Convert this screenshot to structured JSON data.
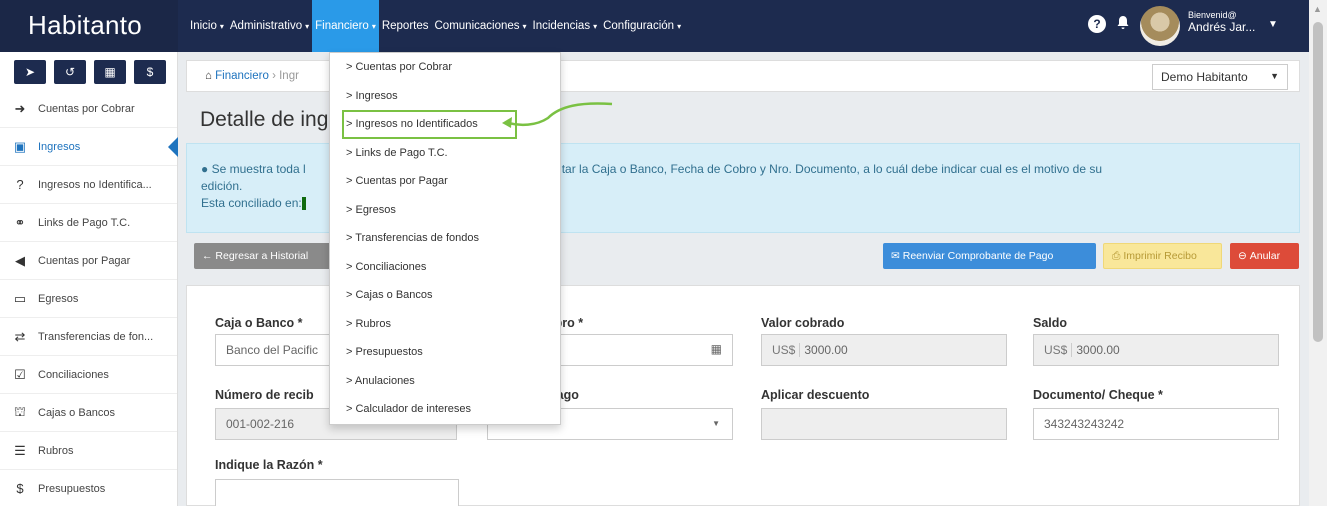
{
  "brand": "Habitanto",
  "nav": [
    {
      "label": "Inicio"
    },
    {
      "label": "Administrativo"
    },
    {
      "label": "Financiero"
    },
    {
      "label": "Reportes"
    },
    {
      "label": "Comunicaciones"
    },
    {
      "label": "Incidencias"
    },
    {
      "label": "Configuración"
    }
  ],
  "user": {
    "greeting": "Bienvenid@",
    "name": "Andrés Jar..."
  },
  "icons": {
    "help": "question-circle-icon",
    "bell": "bell-icon"
  },
  "sidebar": {
    "quick": [
      "send-icon",
      "history-icon",
      "calculator-icon",
      "dollar-icon"
    ],
    "items": [
      {
        "label": "Cuentas por Cobrar",
        "icon": "arrow-circle-right-icon"
      },
      {
        "label": "Ingresos",
        "icon": "money-icon"
      },
      {
        "label": "Ingresos no Identifica...",
        "icon": "question-circle-icon"
      },
      {
        "label": "Links de Pago T.C.",
        "icon": "link-icon"
      },
      {
        "label": "Cuentas por Pagar",
        "icon": "arrow-circle-left-icon"
      },
      {
        "label": "Egresos",
        "icon": "credit-card-icon"
      },
      {
        "label": "Transferencias de fon...",
        "icon": "exchange-icon"
      },
      {
        "label": "Conciliaciones",
        "icon": "check-square-icon"
      },
      {
        "label": "Cajas o Bancos",
        "icon": "bank-icon"
      },
      {
        "label": "Rubros",
        "icon": "list-icon"
      },
      {
        "label": "Presupuestos",
        "icon": "dollar-icon"
      }
    ]
  },
  "breadcrumb": {
    "root": "Financiero",
    "current": "Ingr"
  },
  "company_select": "Demo Habitanto",
  "page_title": "Detalle de ing",
  "info": {
    "line1_a": "Se muestra toda l",
    "line1_b": "ción. Puede Editar la Caja o Banco, Fecha de Cobro y Nro. Documento, a lo cuál debe indicar cual es el motivo de su",
    "line2": "edición.",
    "line3": "Esta conciliado en:"
  },
  "buttons": {
    "back": "Regresar a Historial",
    "resend": "Reenviar Comprobante de Pago",
    "print": "Imprimir Recibo",
    "annul": "Anular"
  },
  "form": {
    "caja_label": "Caja o Banco *",
    "caja_value": "Banco del Pacific",
    "fecha_label": "obro *",
    "valor_label": "Valor cobrado",
    "valor_prefix": "US$",
    "valor_value": "3000.00",
    "saldo_label": "Saldo",
    "saldo_prefix": "US$",
    "saldo_value": "3000.00",
    "recibo_label": "Número de recib",
    "recibo_value": "001-002-216",
    "pago_label": "pago",
    "descuento_label": "Aplicar descuento",
    "documento_label": "Documento/ Cheque *",
    "documento_value": "343243243242",
    "razon_label": "Indique la Razón *"
  },
  "dropdown": [
    "> Cuentas por Cobrar",
    "> Ingresos",
    "> Ingresos no Identificados",
    "> Links de Pago T.C.",
    "> Cuentas por Pagar",
    "> Egresos",
    "> Transferencias de fondos",
    "> Conciliaciones",
    "> Cajas o Bancos",
    "> Rubros",
    "> Presupuestos",
    "> Anulaciones",
    "> Calculador de intereses"
  ],
  "colors": {
    "navbar": "#1d2b4f",
    "active_menu": "#2a9ae8",
    "highlight": "#7ac143",
    "link": "#1e73be"
  }
}
